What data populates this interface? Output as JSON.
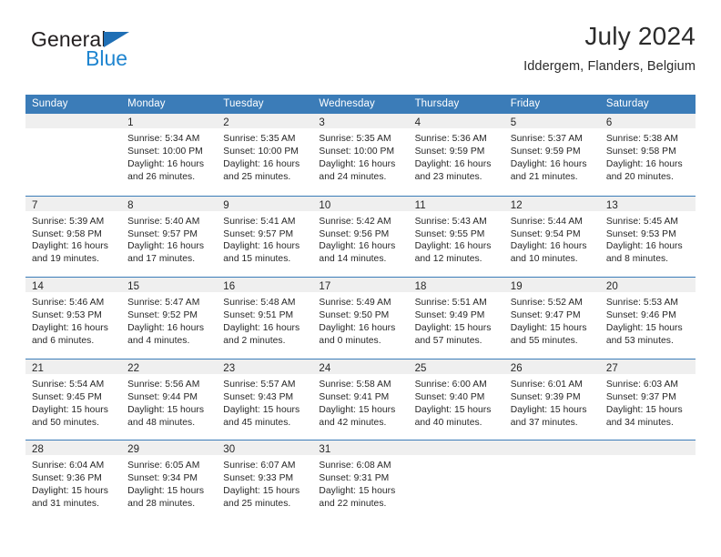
{
  "brand": {
    "name_part1": "General",
    "name_part2": "Blue",
    "accent_color": "#1f85d0",
    "triangle_color": "#1f6fb5"
  },
  "header": {
    "title": "July 2024",
    "subtitle": "Iddergem, Flanders, Belgium"
  },
  "calendar": {
    "header_color": "#3b7cb8",
    "day_band_color": "#efefef",
    "weekdays": [
      "Sunday",
      "Monday",
      "Tuesday",
      "Wednesday",
      "Thursday",
      "Friday",
      "Saturday"
    ],
    "weeks": [
      [
        {
          "day": "",
          "lines": []
        },
        {
          "day": "1",
          "lines": [
            "Sunrise: 5:34 AM",
            "Sunset: 10:00 PM",
            "Daylight: 16 hours",
            "and 26 minutes."
          ]
        },
        {
          "day": "2",
          "lines": [
            "Sunrise: 5:35 AM",
            "Sunset: 10:00 PM",
            "Daylight: 16 hours",
            "and 25 minutes."
          ]
        },
        {
          "day": "3",
          "lines": [
            "Sunrise: 5:35 AM",
            "Sunset: 10:00 PM",
            "Daylight: 16 hours",
            "and 24 minutes."
          ]
        },
        {
          "day": "4",
          "lines": [
            "Sunrise: 5:36 AM",
            "Sunset: 9:59 PM",
            "Daylight: 16 hours",
            "and 23 minutes."
          ]
        },
        {
          "day": "5",
          "lines": [
            "Sunrise: 5:37 AM",
            "Sunset: 9:59 PM",
            "Daylight: 16 hours",
            "and 21 minutes."
          ]
        },
        {
          "day": "6",
          "lines": [
            "Sunrise: 5:38 AM",
            "Sunset: 9:58 PM",
            "Daylight: 16 hours",
            "and 20 minutes."
          ]
        }
      ],
      [
        {
          "day": "7",
          "lines": [
            "Sunrise: 5:39 AM",
            "Sunset: 9:58 PM",
            "Daylight: 16 hours",
            "and 19 minutes."
          ]
        },
        {
          "day": "8",
          "lines": [
            "Sunrise: 5:40 AM",
            "Sunset: 9:57 PM",
            "Daylight: 16 hours",
            "and 17 minutes."
          ]
        },
        {
          "day": "9",
          "lines": [
            "Sunrise: 5:41 AM",
            "Sunset: 9:57 PM",
            "Daylight: 16 hours",
            "and 15 minutes."
          ]
        },
        {
          "day": "10",
          "lines": [
            "Sunrise: 5:42 AM",
            "Sunset: 9:56 PM",
            "Daylight: 16 hours",
            "and 14 minutes."
          ]
        },
        {
          "day": "11",
          "lines": [
            "Sunrise: 5:43 AM",
            "Sunset: 9:55 PM",
            "Daylight: 16 hours",
            "and 12 minutes."
          ]
        },
        {
          "day": "12",
          "lines": [
            "Sunrise: 5:44 AM",
            "Sunset: 9:54 PM",
            "Daylight: 16 hours",
            "and 10 minutes."
          ]
        },
        {
          "day": "13",
          "lines": [
            "Sunrise: 5:45 AM",
            "Sunset: 9:53 PM",
            "Daylight: 16 hours",
            "and 8 minutes."
          ]
        }
      ],
      [
        {
          "day": "14",
          "lines": [
            "Sunrise: 5:46 AM",
            "Sunset: 9:53 PM",
            "Daylight: 16 hours",
            "and 6 minutes."
          ]
        },
        {
          "day": "15",
          "lines": [
            "Sunrise: 5:47 AM",
            "Sunset: 9:52 PM",
            "Daylight: 16 hours",
            "and 4 minutes."
          ]
        },
        {
          "day": "16",
          "lines": [
            "Sunrise: 5:48 AM",
            "Sunset: 9:51 PM",
            "Daylight: 16 hours",
            "and 2 minutes."
          ]
        },
        {
          "day": "17",
          "lines": [
            "Sunrise: 5:49 AM",
            "Sunset: 9:50 PM",
            "Daylight: 16 hours",
            "and 0 minutes."
          ]
        },
        {
          "day": "18",
          "lines": [
            "Sunrise: 5:51 AM",
            "Sunset: 9:49 PM",
            "Daylight: 15 hours",
            "and 57 minutes."
          ]
        },
        {
          "day": "19",
          "lines": [
            "Sunrise: 5:52 AM",
            "Sunset: 9:47 PM",
            "Daylight: 15 hours",
            "and 55 minutes."
          ]
        },
        {
          "day": "20",
          "lines": [
            "Sunrise: 5:53 AM",
            "Sunset: 9:46 PM",
            "Daylight: 15 hours",
            "and 53 minutes."
          ]
        }
      ],
      [
        {
          "day": "21",
          "lines": [
            "Sunrise: 5:54 AM",
            "Sunset: 9:45 PM",
            "Daylight: 15 hours",
            "and 50 minutes."
          ]
        },
        {
          "day": "22",
          "lines": [
            "Sunrise: 5:56 AM",
            "Sunset: 9:44 PM",
            "Daylight: 15 hours",
            "and 48 minutes."
          ]
        },
        {
          "day": "23",
          "lines": [
            "Sunrise: 5:57 AM",
            "Sunset: 9:43 PM",
            "Daylight: 15 hours",
            "and 45 minutes."
          ]
        },
        {
          "day": "24",
          "lines": [
            "Sunrise: 5:58 AM",
            "Sunset: 9:41 PM",
            "Daylight: 15 hours",
            "and 42 minutes."
          ]
        },
        {
          "day": "25",
          "lines": [
            "Sunrise: 6:00 AM",
            "Sunset: 9:40 PM",
            "Daylight: 15 hours",
            "and 40 minutes."
          ]
        },
        {
          "day": "26",
          "lines": [
            "Sunrise: 6:01 AM",
            "Sunset: 9:39 PM",
            "Daylight: 15 hours",
            "and 37 minutes."
          ]
        },
        {
          "day": "27",
          "lines": [
            "Sunrise: 6:03 AM",
            "Sunset: 9:37 PM",
            "Daylight: 15 hours",
            "and 34 minutes."
          ]
        }
      ],
      [
        {
          "day": "28",
          "lines": [
            "Sunrise: 6:04 AM",
            "Sunset: 9:36 PM",
            "Daylight: 15 hours",
            "and 31 minutes."
          ]
        },
        {
          "day": "29",
          "lines": [
            "Sunrise: 6:05 AM",
            "Sunset: 9:34 PM",
            "Daylight: 15 hours",
            "and 28 minutes."
          ]
        },
        {
          "day": "30",
          "lines": [
            "Sunrise: 6:07 AM",
            "Sunset: 9:33 PM",
            "Daylight: 15 hours",
            "and 25 minutes."
          ]
        },
        {
          "day": "31",
          "lines": [
            "Sunrise: 6:08 AM",
            "Sunset: 9:31 PM",
            "Daylight: 15 hours",
            "and 22 minutes."
          ]
        },
        {
          "day": "",
          "lines": []
        },
        {
          "day": "",
          "lines": []
        },
        {
          "day": "",
          "lines": []
        }
      ]
    ]
  }
}
